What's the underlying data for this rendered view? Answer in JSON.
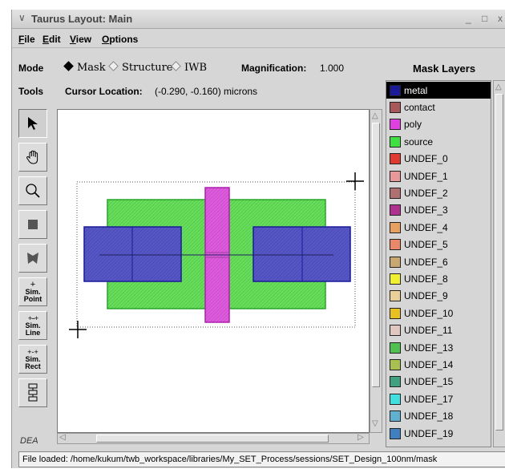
{
  "window": {
    "title": "Taurus Layout: Main",
    "min_glyph": "_",
    "max_glyph": "□",
    "close_glyph": "x"
  },
  "menu": [
    {
      "u": "F",
      "rest": "ile"
    },
    {
      "u": "E",
      "rest": "dit"
    },
    {
      "u": "V",
      "rest": "iew"
    },
    {
      "u": "O",
      "rest": "ptions"
    }
  ],
  "mode": {
    "label": "Mode",
    "options": [
      {
        "label": "Mask",
        "selected": true
      },
      {
        "label": "Structure",
        "selected": false
      },
      {
        "label": "IWB",
        "selected": false
      }
    ],
    "magnification_label": "Magnification:",
    "magnification_value": "1.000"
  },
  "tools": {
    "label": "Tools",
    "cursor_label": "Cursor Location:",
    "cursor_value": "(-0.290, -0.160) microns",
    "sim_point": [
      "Sim.",
      "Point"
    ],
    "sim_line": [
      "Sim.",
      "Line"
    ],
    "sim_rect": [
      "Sim.",
      "Rect"
    ],
    "bottom_partial": "DEA"
  },
  "mask_layers": {
    "title": "Mask Layers",
    "items": [
      {
        "label": "metal",
        "color": "#1a1a9a",
        "selected": true
      },
      {
        "label": "contact",
        "color": "#a85858"
      },
      {
        "label": "poly",
        "color": "#e040e0"
      },
      {
        "label": "source",
        "color": "#40e040"
      },
      {
        "label": "UNDEF_0",
        "color": "#e03a30"
      },
      {
        "label": "UNDEF_1",
        "color": "#e89898"
      },
      {
        "label": "UNDEF_2",
        "color": "#b07070"
      },
      {
        "label": "UNDEF_3",
        "color": "#b03090"
      },
      {
        "label": "UNDEF_4",
        "color": "#e8a060"
      },
      {
        "label": "UNDEF_5",
        "color": "#e88868"
      },
      {
        "label": "UNDEF_6",
        "color": "#c8a870"
      },
      {
        "label": "UNDEF_8",
        "color": "#f0f030"
      },
      {
        "label": "UNDEF_9",
        "color": "#e8d098"
      },
      {
        "label": "UNDEF_10",
        "color": "#e8c020"
      },
      {
        "label": "UNDEF_11",
        "color": "#e0c8c0"
      },
      {
        "label": "UNDEF_13",
        "color": "#50c050"
      },
      {
        "label": "UNDEF_14",
        "color": "#a8c050"
      },
      {
        "label": "UNDEF_15",
        "color": "#40a080"
      },
      {
        "label": "UNDEF_17",
        "color": "#40e0e0"
      },
      {
        "label": "UNDEF_18",
        "color": "#60b0d0"
      },
      {
        "label": "UNDEF_19",
        "color": "#4080c0"
      }
    ]
  },
  "status": "File loaded:  /home/kukum/twb_workspace/libraries/My_SET_Process/sessions/SET_Design_100nm/mask"
}
